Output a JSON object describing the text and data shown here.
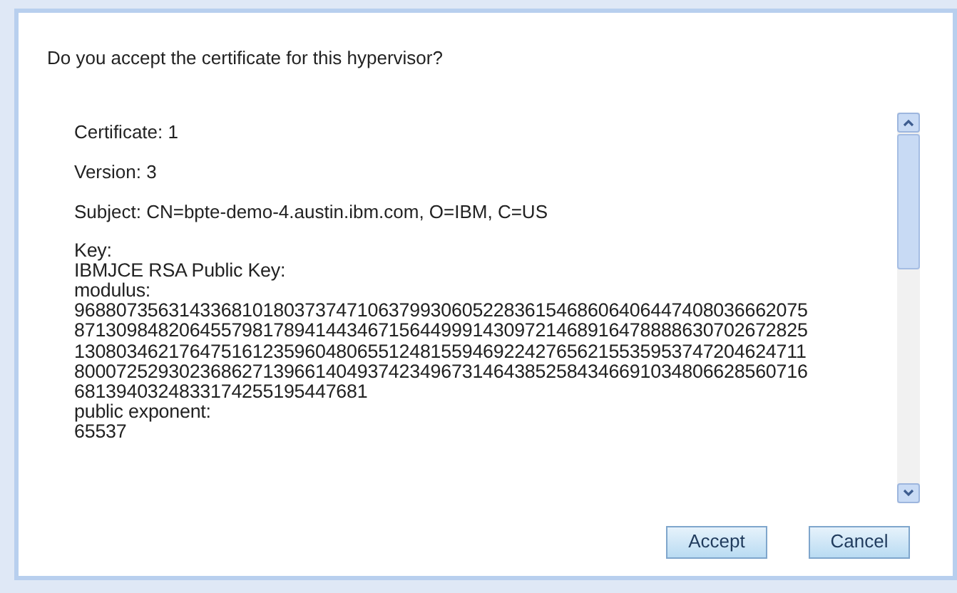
{
  "dialog": {
    "question": "Do you accept the certificate for this hypervisor?",
    "fields": [
      "Certificate: 1",
      "Version: 3",
      "Subject: CN=bpte-demo-4.austin.ibm.com, O=IBM, C=US"
    ],
    "key_lines": [
      "Key:",
      "IBMJCE RSA Public Key:",
      "modulus:",
      "9688073563143368101803737471063799306052283615468606406447408036662075",
      "8713098482064557981789414434671564499914309721468916478888630702672825",
      "1308034621764751612359604806551248155946922427656215535953747204624711",
      "8000725293023686271396614049374234967314643852584346691034806628560716",
      "6813940324833174255195447681",
      "public exponent:",
      "65537"
    ],
    "buttons": [
      "Accept",
      "Cancel"
    ]
  }
}
